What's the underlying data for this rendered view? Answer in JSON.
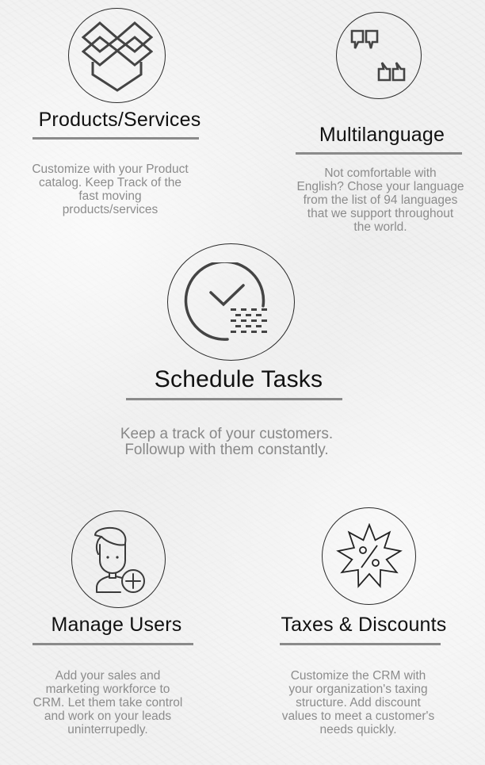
{
  "features": [
    {
      "id": "products-services",
      "icon": "open-box-icon",
      "title": "Products/Services",
      "description_lines": [
        "Customize with your Product",
        "catalog. Keep Track of the",
        "fast moving",
        "products/services"
      ]
    },
    {
      "id": "multilanguage",
      "icon": "quote-marks-icon",
      "title": "Multilanguage",
      "description_lines": [
        "Not comfortable with",
        "English? Chose your language",
        "from the list of 94 languages",
        "that we support throughout",
        "the world."
      ]
    },
    {
      "id": "schedule-tasks",
      "icon": "clock-check-icon",
      "title": "Schedule Tasks",
      "description_lines": [
        "Keep a track of your customers.",
        "Followup with them constantly."
      ]
    },
    {
      "id": "manage-users",
      "icon": "user-add-icon",
      "title": "Manage Users",
      "description_lines": [
        "Add your sales and",
        "marketing workforce to",
        "CRM. Let them take control",
        "and work on your leads",
        "uninterrupedly."
      ]
    },
    {
      "id": "taxes-discounts",
      "icon": "percent-badge-icon",
      "title": "Taxes & Discounts",
      "description_lines": [
        "Customize the CRM with",
        "your organization's taxing",
        "structure. Add discount",
        "values to meet a customer's",
        "needs quickly."
      ]
    }
  ],
  "colors": {
    "title": "#111111",
    "description": "#8c8c8c",
    "divider": "#8a8a8a",
    "icon_stroke": "#444444",
    "background": "#f1f1f1"
  }
}
